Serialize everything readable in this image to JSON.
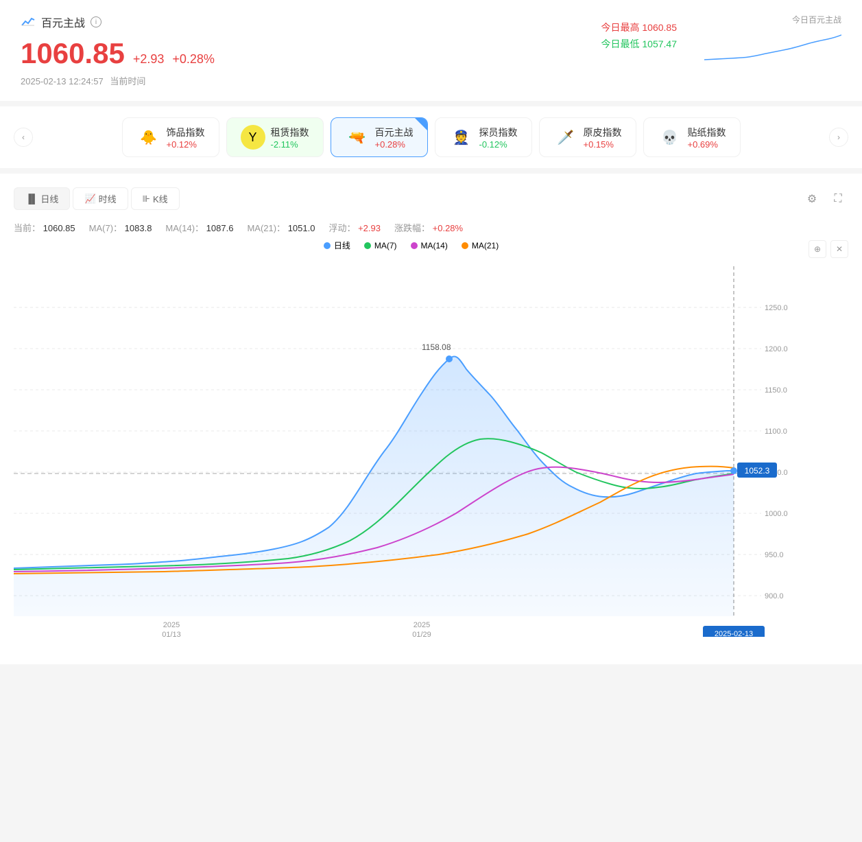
{
  "header": {
    "icon_char": "📈",
    "title": "百元主战",
    "main_price": "1060.85",
    "price_change": "+2.93",
    "price_change_pct": "+0.28%",
    "date_time": "2025-02-13 12:24:57",
    "date_label": "当前时间",
    "today_high_label": "今日最高",
    "today_high_val": "1060.85",
    "today_low_label": "今日最低",
    "today_low_val": "1057.47",
    "mini_chart_label": "今日百元主战"
  },
  "tabs": [
    {
      "id": "cosmetics",
      "icon": "🐥",
      "name": "饰品指数",
      "change": "+0.12%",
      "positive": true
    },
    {
      "id": "rental",
      "icon": "🟡",
      "name": "租赁指数",
      "change": "-2.11%",
      "positive": false
    },
    {
      "id": "hundred",
      "icon": "🔫",
      "name": "百元主战",
      "change": "+0.28%",
      "positive": true,
      "active": true
    },
    {
      "id": "scout",
      "icon": "👮",
      "name": "探员指数",
      "change": "-0.12%",
      "positive": false
    },
    {
      "id": "original",
      "icon": "🗡️",
      "name": "原皮指数",
      "change": "+0.15%",
      "positive": true
    },
    {
      "id": "sticker",
      "icon": "💀",
      "name": "贴纸指数",
      "change": "+0.69%",
      "positive": true
    }
  ],
  "chart": {
    "type_tabs": [
      {
        "id": "daily",
        "icon": "📊",
        "label": "日线",
        "active": true
      },
      {
        "id": "time",
        "icon": "📈",
        "label": "时线",
        "active": false
      },
      {
        "id": "kline",
        "icon": "📉",
        "label": "K线",
        "active": false
      }
    ],
    "stats": {
      "current_label": "当前：",
      "current_val": "1060.85",
      "ma7_label": "MA(7)：",
      "ma7_val": "1083.8",
      "ma14_label": "MA(14)：",
      "ma14_val": "1087.6",
      "ma21_label": "MA(21)：",
      "ma21_val": "1051.0",
      "float_label": "浮动：",
      "float_val": "+2.93",
      "change_label": "涨跌幅：",
      "change_val": "+0.28%"
    },
    "legend": [
      {
        "label": "日线",
        "color": "#4a9eff",
        "type": "dot"
      },
      {
        "label": "MA(7)",
        "color": "#22c55e",
        "type": "dot"
      },
      {
        "label": "MA(14)",
        "color": "#cc44cc",
        "type": "dot"
      },
      {
        "label": "MA(21)",
        "color": "#ff8c00",
        "type": "dot"
      }
    ],
    "y_labels": [
      "1250.0",
      "1200.0",
      "1150.0",
      "1100.0",
      "1050.0",
      "1000.0",
      "950.0",
      "900.0"
    ],
    "x_labels": [
      {
        "line1": "2025",
        "line2": "01/13"
      },
      {
        "line1": "2025",
        "line2": "01/29"
      },
      {
        "line1": "2025-02-",
        "line2": "02/13"
      }
    ],
    "peak_label": "1158.08",
    "tooltip_val": "1052.3",
    "current_date": "2025-02-13"
  }
}
